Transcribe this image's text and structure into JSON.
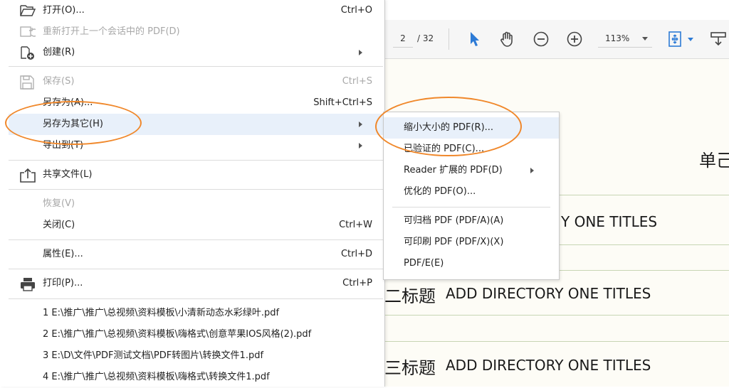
{
  "toolbar": {
    "page_current": "2",
    "page_total": "/ 32",
    "zoom": "113%",
    "icons": [
      "select-arrow-icon",
      "hand-icon",
      "zoom-out-icon",
      "zoom-in-icon",
      "fit-page-icon",
      "download-icon"
    ]
  },
  "document": {
    "heading_partial": "单己",
    "line1": "Y ONE TITLES",
    "line2_cn": "二标题",
    "line2_en": "ADD DIRECTORY ONE TITLES",
    "line3_cn": "三标题",
    "line3_en": "ADD DIRECTORY ONE TITLES"
  },
  "menu": {
    "open": {
      "label": "打开(O)...",
      "shortcut": "Ctrl+O"
    },
    "reopen": {
      "label": "重新打开上一个会话中的 PDF(D)"
    },
    "create": {
      "label": "创建(R)"
    },
    "save": {
      "label": "保存(S)",
      "shortcut": "Ctrl+S"
    },
    "save_as": {
      "label": "另存为(A)...",
      "shortcut": "Shift+Ctrl+S"
    },
    "save_as_other": {
      "label": "另存为其它(H)"
    },
    "export_to": {
      "label": "导出到(T)"
    },
    "share": {
      "label": "共享文件(L)"
    },
    "revert": {
      "label": "恢复(V)"
    },
    "close": {
      "label": "关闭(C)",
      "shortcut": "Ctrl+W"
    },
    "properties": {
      "label": "属性(E)...",
      "shortcut": "Ctrl+D"
    },
    "print": {
      "label": "打印(P)...",
      "shortcut": "Ctrl+P"
    },
    "recent": [
      "1 E:\\推广\\推广\\总视频\\资料模板\\小清新动态水彩绿叶.pdf",
      "2 E:\\推广\\推广\\总视频\\资料模板\\嗨格式\\创意苹果IOS风格(2).pdf",
      "3 E:\\D\\文件\\PDF测试文档\\PDF转图片\\转换文件1.pdf",
      "4 E:\\推广\\推广\\总视频\\资料模板\\嗨格式\\转换文件1.pdf"
    ]
  },
  "submenu": {
    "reduce": "缩小大小的 PDF(R)...",
    "certified": "已验证的 PDF(C)...",
    "reader_ext": "Reader 扩展的 PDF(D)",
    "optimized": "优化的 PDF(O)...",
    "pdfa": "可归档 PDF (PDF/A)(A)",
    "pdfx": "可印刷 PDF (PDF/X)(X)",
    "pdfe": "PDF/E(E)"
  },
  "colors": {
    "highlight": "#e8f0fa",
    "annotation": "#f0882b",
    "accent": "#2d7bd6",
    "disabled_text": "#a8a8a8"
  }
}
